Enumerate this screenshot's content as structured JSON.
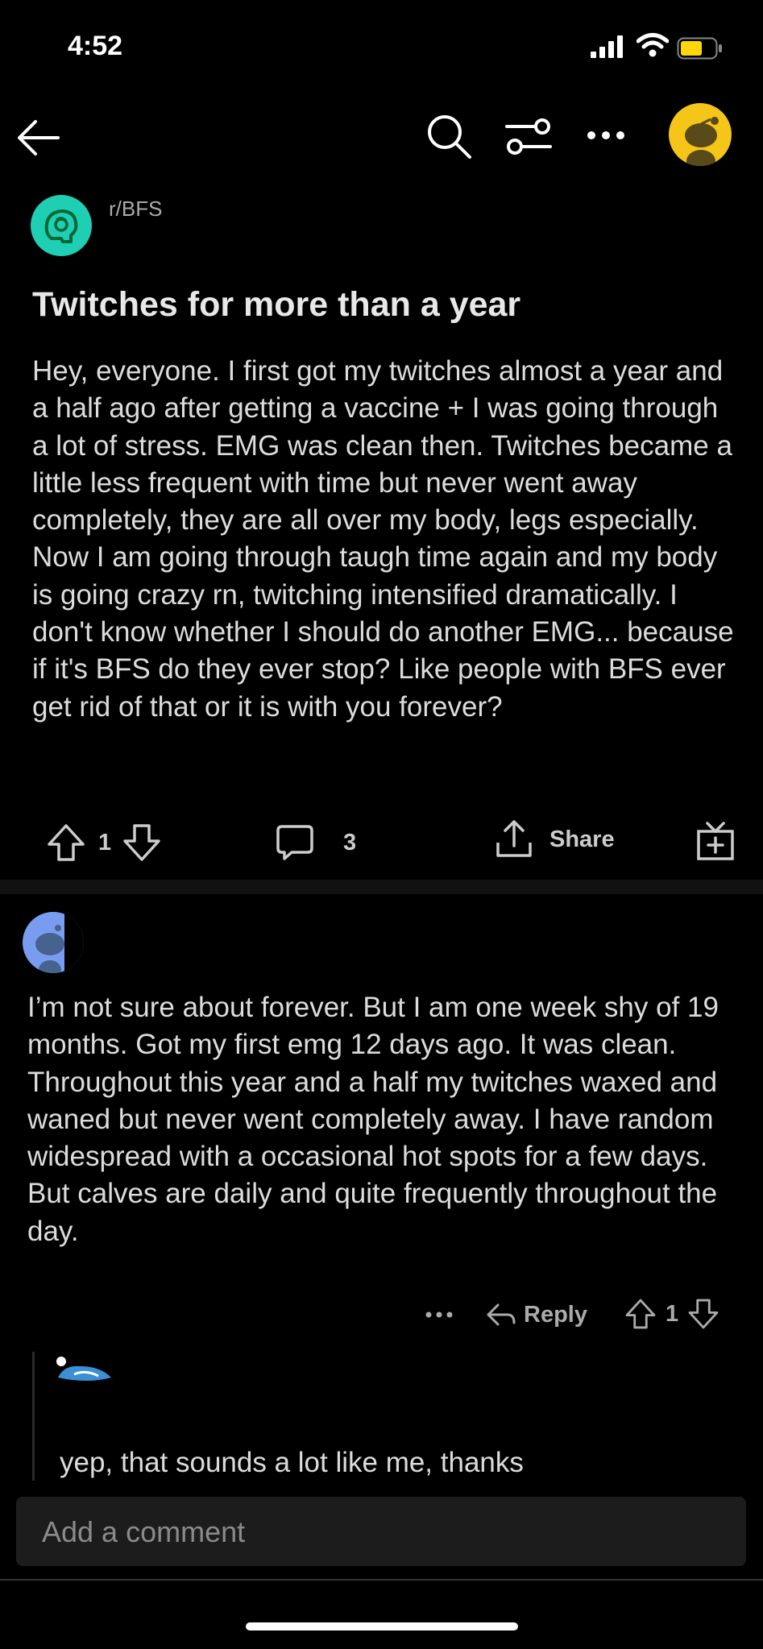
{
  "status": {
    "time": "4:52"
  },
  "subreddit": {
    "name": "r/BFS"
  },
  "post": {
    "title": "Twitches for more than a year",
    "body": "Hey, everyone. I first got my twitches almost a year and a half ago after getting a vaccine + I was going through a lot of stress. EMG was clean then. Twitches became a little less frequent with time but never went away completely, they are all over my body, legs especially. Now I am going through taugh time again and my body is going crazy rn, twitching intensified dramatically. I don't know whether I should do another EMG... because if it's BFS do they ever stop? Like people with BFS ever get rid of that or it is with you forever?",
    "votes": "1",
    "comments": "3",
    "share_label": "Share"
  },
  "comment": {
    "body": "I’m not sure about forever. But I am one week shy of 19 months.  Got my first emg 12 days ago.  It was clean.   Throughout this year and a half my twitches waxed and waned but never went completely away.   I have random widespread with a occasional hot spots for a few days.   But calves are daily and quite frequently throughout the day.",
    "reply_label": "Reply",
    "votes": "1"
  },
  "reply": {
    "body": "yep, that sounds a lot like me, thanks"
  },
  "composer": {
    "placeholder": "Add a comment"
  },
  "colors": {
    "subreddit_icon": "#1fcfb4",
    "profile_avatar": "#f5c518",
    "comment_avatar": "#7a9cf0"
  },
  "icons": [
    "back-arrow-icon",
    "search-icon",
    "filter-icon",
    "more-icon",
    "upvote-icon",
    "downvote-icon",
    "comment-icon",
    "share-icon",
    "award-icon",
    "reply-icon"
  ]
}
